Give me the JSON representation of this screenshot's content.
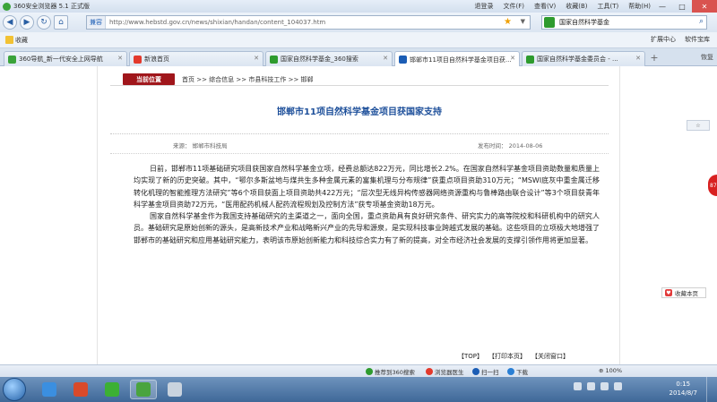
{
  "browser": {
    "title": "360安全浏览器 5.1 正式版",
    "menu": [
      "退登录",
      "文件(F)",
      "查看(V)",
      "收藏(B)",
      "工具(T)",
      "帮助(H)"
    ],
    "window_buttons": [
      "—",
      "□",
      "✕"
    ]
  },
  "address": {
    "mode": "兼容",
    "url": "http://www.hebstd.gov.cn/news/shixian/handan/content_104037.htm",
    "search_text": "国家自然科学基金"
  },
  "favorites": {
    "label": "收藏",
    "right_items": [
      "扩展中心",
      "软件宝库"
    ]
  },
  "tabs": [
    {
      "label": "360导航_新一代安全上网导航",
      "color": "#3aa33a"
    },
    {
      "label": "新浪首页",
      "color": "#e3392c"
    },
    {
      "label": "国家自然科学基金_360搜索",
      "color": "#2e9b2e"
    },
    {
      "label": "邯郸市11项目自然科学基金项目获...",
      "color": "#1b5db5",
      "active": true
    },
    {
      "label": "国家自然科学基金委员会 - ...",
      "color": "#2e9b2e"
    }
  ],
  "tab_new": "+",
  "tab_restore": "恢复",
  "page": {
    "location_label": "当前位置",
    "breadcrumb": "首页 >> 综合信息 >> 市县科技工作 >> 邯郸",
    "title": "邯郸市11项自然科学基金项目获国家支持",
    "source": "来源：   邯郸市科技局",
    "date": "发布时间：  2014-08-06",
    "paragraphs": [
      "日前，邯郸市11项基础研究项目获国家自然科学基金立项，经费总额达822万元，同比增长2.2%。在国家自然科学基金项目资助数量和质量上均实现了新的历史突破。其中，“鄂尔多斯盆地与煤共生多种金属元素的富集机理与分布规律”获重点项目资助310万元；“MSWI底灰中重金属迁移转化机理的智能推理方法研究”等6个项目获面上项目资助共422万元；“层次型无线异构传感器网络资源重构与鲁棒路由联合设计”等3个项目获青年科学基金项目资助72万元，“医用配药机械人配药流程规划及控制方法”获专项基金资助18万元。",
      "国家自然科学基金作为我国支持基础研究的主渠道之一，面向全国，重点资助具有良好研究条件、研究实力的高等院校和科研机构中的研究人员。基础研究是原始创新的源头，是高新技术产业和战略新兴产业的先导和源泉，是实现科技事业跨越式发展的基础。这些项目的立项极大地增强了邯郸市的基础研究和应用基础研究能力，表明该市原始创新能力和科技综合实力有了新的提高，对全市经济社会发展的支撑引领作用将更加显著。"
    ],
    "footer_links": [
      "【TOP】",
      "【打印本页】",
      "【关闭窗口】"
    ]
  },
  "float": {
    "top_widget": "☆",
    "ad_text": "87",
    "collect": "收藏本页"
  },
  "status": {
    "items": [
      "推荐到360搜索",
      "浏览器医生",
      "扫一扫",
      "下载"
    ],
    "zoom": "100%"
  },
  "taskbar": {
    "time": "0:15",
    "date": "2014/8/7"
  }
}
